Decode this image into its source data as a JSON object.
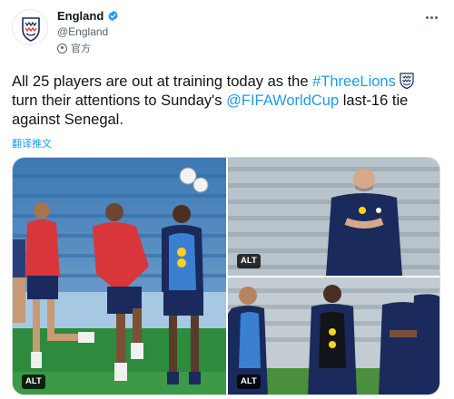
{
  "author": {
    "display_name": "England",
    "handle": "@England",
    "label": "官方",
    "avatar_icon": "england-crest-icon",
    "verified_icon": "verified-badge-icon"
  },
  "tweet": {
    "part1": "All 25 players are out at training today as the ",
    "hashtag": "#ThreeLions",
    "part2": " turn their attentions to Sunday's ",
    "mention": "@FIFAWorldCup",
    "part3": " last-16 tie against Senegal."
  },
  "translate_label": "翻译推文",
  "media": [
    {
      "alt_label": "ALT"
    },
    {
      "alt_label": "ALT"
    },
    {
      "alt_label": "ALT"
    }
  ],
  "colors": {
    "link": "#1d9bf0",
    "verified": "#1d9bf0",
    "england_navy": "#1b2a5c",
    "training_red": "#d8363a"
  }
}
